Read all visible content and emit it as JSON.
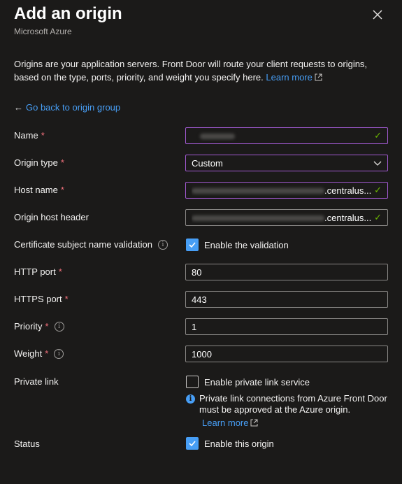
{
  "panel": {
    "title": "Add an origin",
    "subtitle": "Microsoft Azure",
    "description": "Origins are your application servers. Front Door will route your client requests to origins, based on the type, ports, priority, and weight you specify here.",
    "learn_more": "Learn more",
    "back_link": "Go back to origin group"
  },
  "form": {
    "name": {
      "label": "Name",
      "value": ""
    },
    "origin_type": {
      "label": "Origin type",
      "value": "Custom"
    },
    "host_name": {
      "label": "Host name",
      "value_suffix": ".centralus...."
    },
    "origin_host_header": {
      "label": "Origin host header",
      "value_suffix": ".centralus...."
    },
    "cert_validation": {
      "label": "Certificate subject name validation",
      "checkbox_label": "Enable the validation",
      "checked": true
    },
    "http_port": {
      "label": "HTTP port",
      "value": "80"
    },
    "https_port": {
      "label": "HTTPS port",
      "value": "443"
    },
    "priority": {
      "label": "Priority",
      "value": "1"
    },
    "weight": {
      "label": "Weight",
      "value": "1000"
    },
    "private_link": {
      "label": "Private link",
      "checkbox_label": "Enable private link service",
      "checked": false,
      "info_text": "Private link connections from Azure Front Door must be approved at the Azure origin.",
      "learn_more": "Learn more"
    },
    "status": {
      "label": "Status",
      "checkbox_label": "Enable this origin",
      "checked": true
    }
  },
  "colors": {
    "background": "#1b1a19",
    "accent": "#479ef5",
    "required": "#f1707b",
    "valid_border": "#a25ad2",
    "check": "#6bb700"
  }
}
